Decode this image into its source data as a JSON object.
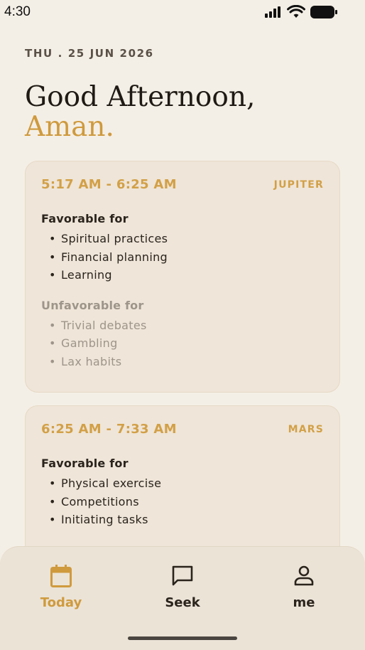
{
  "status_bar": {
    "time": "4:30"
  },
  "header": {
    "date": "THU  .  25 JUN 2026",
    "greeting": "Good Afternoon,",
    "name": "Aman."
  },
  "cards": [
    {
      "time_range": "5:17 AM - 6:25 AM",
      "planet": "JUPITER",
      "favorable_title": "Favorable for",
      "favorable": [
        "Spiritual practices",
        "Financial planning",
        "Learning"
      ],
      "unfavorable_title": "Unfavorable for",
      "unfavorable": [
        "Trivial debates",
        "Gambling",
        "Lax habits"
      ]
    },
    {
      "time_range": "6:25 AM - 7:33 AM",
      "planet": "MARS",
      "favorable_title": "Favorable for",
      "favorable": [
        "Physical exercise",
        "Competitions",
        "Initiating tasks"
      ]
    }
  ],
  "nav": {
    "items": [
      {
        "label": "Today",
        "icon": "calendar-icon",
        "active": true
      },
      {
        "label": "Seek",
        "icon": "chat-icon",
        "active": false
      },
      {
        "label": "me",
        "icon": "person-icon",
        "active": false
      }
    ],
    "accent_color": "#cf9a3d"
  },
  "colors": {
    "background": "#f4efe6",
    "card": "#efe5d8",
    "accent": "#d2a047",
    "muted": "#9e958a"
  }
}
